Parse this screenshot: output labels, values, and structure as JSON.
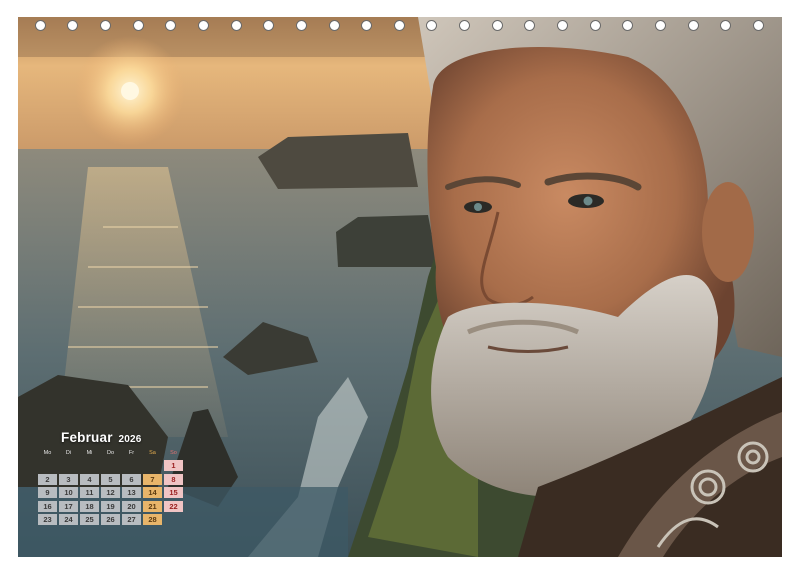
{
  "calendar": {
    "month": "Februar",
    "year": "2026",
    "weekdays": [
      "Mo",
      "Di",
      "Mi",
      "Do",
      "Fr",
      "Sa",
      "So"
    ],
    "weeks": [
      [
        "",
        "",
        "",
        "",
        "",
        "",
        "1"
      ],
      [
        "2",
        "3",
        "4",
        "5",
        "6",
        "7",
        "8"
      ],
      [
        "9",
        "10",
        "11",
        "12",
        "13",
        "14",
        "15"
      ],
      [
        "16",
        "17",
        "18",
        "19",
        "20",
        "21",
        "22"
      ],
      [
        "23",
        "24",
        "25",
        "26",
        "27",
        "28",
        ""
      ]
    ]
  },
  "colors": {
    "weekday_cell": "#b8bcc0",
    "saturday_cell": "#e8b56a",
    "sunday_cell": "#f0c4c4"
  },
  "image": {
    "subject": "elderly bearded man with grey hair beside a sunset sea coast with cliffs"
  }
}
